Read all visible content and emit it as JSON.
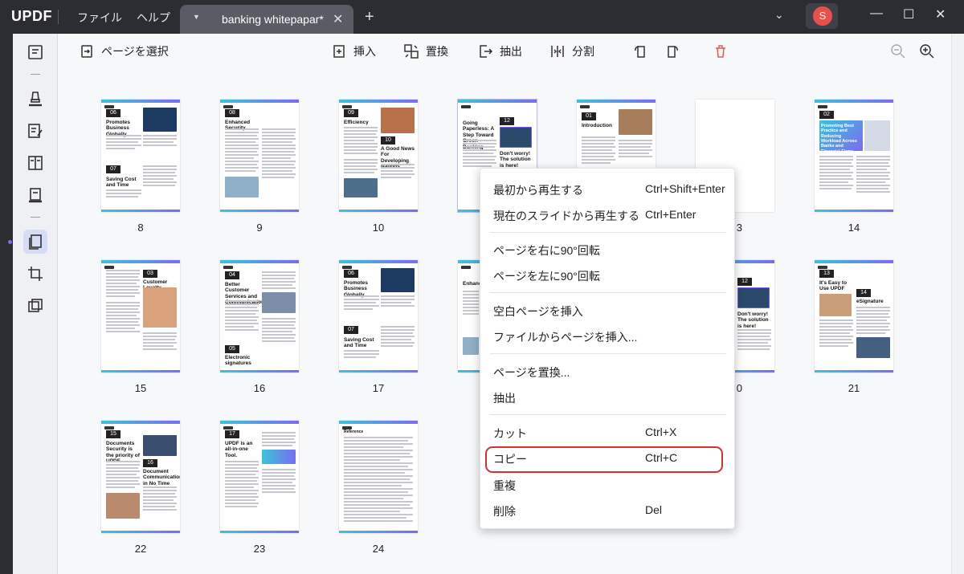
{
  "app": {
    "logo": "UPDF"
  },
  "titlebar": {
    "menus": [
      "ファイル",
      "ヘルプ"
    ],
    "tab_title": "banking whitepapar*",
    "avatar_letter": "S"
  },
  "toolbar": {
    "select_pages": "ページを選択",
    "insert": "挿入",
    "replace": "置換",
    "extract": "抽出",
    "split": "分割"
  },
  "pages": {
    "row1": [
      "8",
      "9",
      "10",
      "",
      "",
      "",
      "14"
    ],
    "row2": [
      "15",
      "16",
      "17",
      "",
      "",
      "20",
      "21"
    ],
    "row3": [
      "22",
      "23",
      "24"
    ],
    "partial_3": "3",
    "partial_20": "0"
  },
  "thumb_text": {
    "p8": {
      "n1": "06",
      "h1": "Promotes Business Globally",
      "n2": "07",
      "h2": "Saving Cost and Time"
    },
    "p9": {
      "n1": "08",
      "h1": "Enhanced Security"
    },
    "p10": {
      "n1": "09",
      "h1": "Efficiency",
      "n2": "10",
      "h2": "A Good News For Developing Nations"
    },
    "p11": {
      "h1": "Going Paperless: A Step Toward Green Banking",
      "n2": "12",
      "h2": "Don't worry! The solution is here!"
    },
    "p12": {
      "n1": "01",
      "h1": "Introduction"
    },
    "p14": {
      "n1": "02",
      "h1": "Promoting Best Practice and Reducing Workload Across Banks and Financial Firms"
    },
    "p15": {
      "n1": "03",
      "h1": "Customer Loyalty"
    },
    "p16": {
      "n1": "04",
      "h1": "Better Customer Services and Communication",
      "n2": "05",
      "h2": "Electronic signatures"
    },
    "p17": {
      "n1": "06",
      "h1": "Promotes Business Globally",
      "n2": "07",
      "h2": "Saving Cost and Time"
    },
    "p18": {
      "h1": "Enhance"
    },
    "p20": {
      "n1": "12",
      "h1": "Don't worry! The solution is here!"
    },
    "p21": {
      "n1": "13",
      "h1": "It's Easy to Use UPDF",
      "n2": "14",
      "h2": "eSignature"
    },
    "p22": {
      "n1": "15",
      "h1": "Documents Security is the priority of UPDF.",
      "n2": "16",
      "h2": "Document Communication in No Time"
    },
    "p23": {
      "n1": "17",
      "h1": "UPDF is an all-in-one Tool."
    },
    "p24": {
      "h1": "Reference"
    }
  },
  "context_menu": [
    {
      "label": "最初から再生する",
      "shortcut": "Ctrl+Shift+Enter"
    },
    {
      "label": "現在のスライドから再生する",
      "shortcut": "Ctrl+Enter"
    },
    {
      "label": "ページを右に90°回転",
      "shortcut": ""
    },
    {
      "label": "ページを左に90°回転",
      "shortcut": ""
    },
    {
      "label": "空白ページを挿入",
      "shortcut": ""
    },
    {
      "label": "ファイルからページを挿入...",
      "shortcut": ""
    },
    {
      "label": "ページを置換...",
      "shortcut": ""
    },
    {
      "label": "抽出",
      "shortcut": ""
    },
    {
      "label": "カット",
      "shortcut": "Ctrl+X"
    },
    {
      "label": "コピー",
      "shortcut": "Ctrl+C"
    },
    {
      "label": "重複",
      "shortcut": ""
    },
    {
      "label": "削除",
      "shortcut": "Del"
    }
  ],
  "highlighted_item": "コピー",
  "colors": {
    "accent_gradient_start": "#3ac4d9",
    "accent_gradient_end": "#7a6cf0",
    "highlight": "#d8312f",
    "avatar": "#e8514a"
  },
  "icons": [
    "page-view-icon",
    "highlighter-icon",
    "edit-text-icon",
    "compare-icon",
    "form-icon",
    "organize-pages-icon",
    "crop-icon",
    "layers-icon",
    "zoom-out-icon",
    "zoom-in-icon",
    "delete-icon",
    "rotate-left-icon",
    "rotate-right-icon"
  ]
}
